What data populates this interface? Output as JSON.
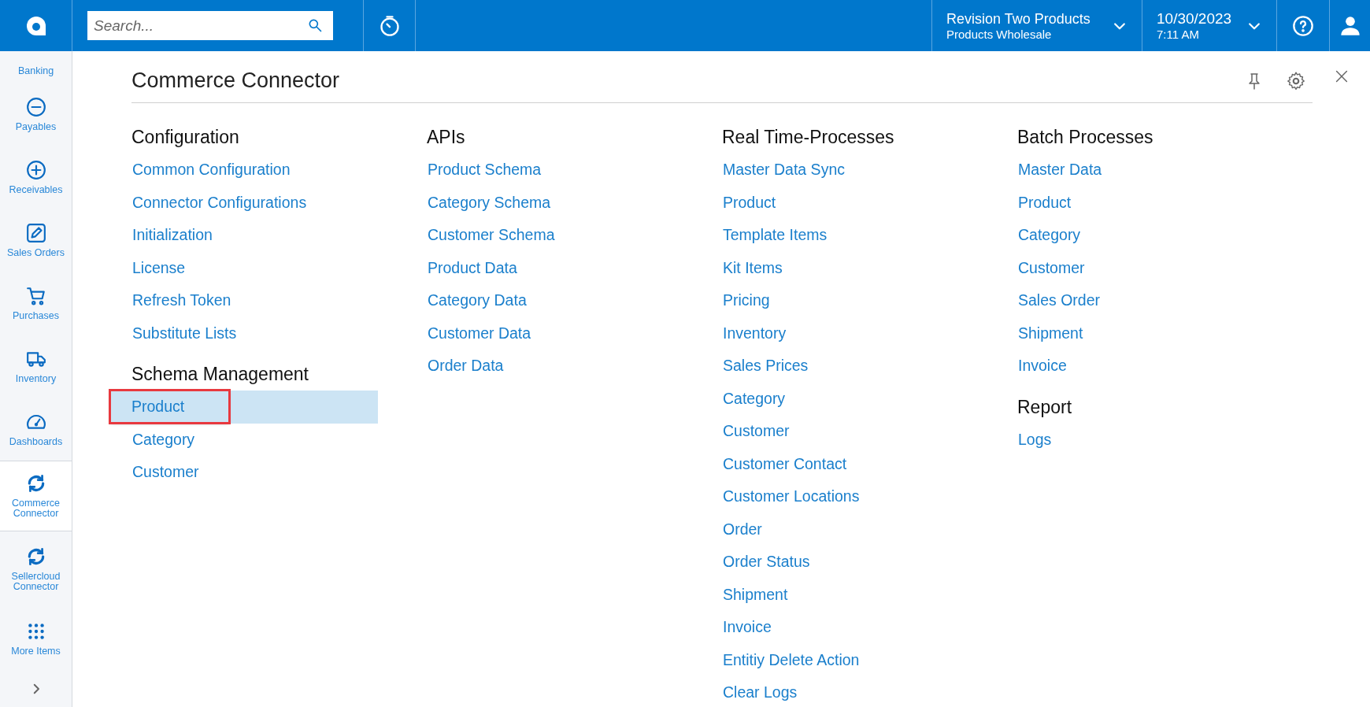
{
  "top_bar": {
    "search": {
      "placeholder": "Search..."
    },
    "company": {
      "name": "Revision Two Products",
      "branch": "Products Wholesale"
    },
    "date": {
      "date": "10/30/2023",
      "time": "7:11 AM"
    }
  },
  "sidebar": {
    "items": [
      {
        "label": "Banking",
        "selected": false
      },
      {
        "label": "Payables",
        "selected": false
      },
      {
        "label": "Receivables",
        "selected": false
      },
      {
        "label": "Sales Orders",
        "selected": false
      },
      {
        "label": "Purchases",
        "selected": false
      },
      {
        "label": "Inventory",
        "selected": false
      },
      {
        "label": "Dashboards",
        "selected": false
      },
      {
        "label": "Commerce Connector",
        "selected": true
      },
      {
        "label": "Sellercloud Connector",
        "selected": false
      },
      {
        "label": "More Items",
        "selected": false
      }
    ]
  },
  "workspace": {
    "title": "Commerce Connector",
    "columns": [
      {
        "groups": [
          {
            "heading": "Configuration",
            "links": [
              {
                "label": "Common Configuration",
                "selected": false,
                "outlined": false
              },
              {
                "label": "Connector Configurations",
                "selected": false,
                "outlined": false
              },
              {
                "label": "Initialization",
                "selected": false,
                "outlined": false
              },
              {
                "label": "License",
                "selected": false,
                "outlined": false
              },
              {
                "label": "Refresh Token",
                "selected": false,
                "outlined": false
              },
              {
                "label": "Substitute Lists",
                "selected": false,
                "outlined": false
              }
            ]
          },
          {
            "heading": "Schema Management",
            "links": [
              {
                "label": "Product",
                "selected": true,
                "outlined": true
              },
              {
                "label": "Category",
                "selected": false,
                "outlined": false
              },
              {
                "label": "Customer",
                "selected": false,
                "outlined": false
              }
            ]
          }
        ]
      },
      {
        "groups": [
          {
            "heading": "APIs",
            "links": [
              {
                "label": "Product Schema",
                "selected": false,
                "outlined": false
              },
              {
                "label": "Category Schema",
                "selected": false,
                "outlined": false
              },
              {
                "label": "Customer Schema",
                "selected": false,
                "outlined": false
              },
              {
                "label": "Product Data",
                "selected": false,
                "outlined": false
              },
              {
                "label": "Category Data",
                "selected": false,
                "outlined": false
              },
              {
                "label": "Customer Data",
                "selected": false,
                "outlined": false
              },
              {
                "label": "Order Data",
                "selected": false,
                "outlined": false
              }
            ]
          }
        ]
      },
      {
        "groups": [
          {
            "heading": "Real Time-Processes",
            "links": [
              {
                "label": "Master Data Sync",
                "selected": false,
                "outlined": false
              },
              {
                "label": "Product",
                "selected": false,
                "outlined": false
              },
              {
                "label": "Template Items",
                "selected": false,
                "outlined": false
              },
              {
                "label": "Kit Items",
                "selected": false,
                "outlined": false
              },
              {
                "label": "Pricing",
                "selected": false,
                "outlined": false
              },
              {
                "label": "Inventory",
                "selected": false,
                "outlined": false
              },
              {
                "label": "Sales Prices",
                "selected": false,
                "outlined": false
              },
              {
                "label": "Category",
                "selected": false,
                "outlined": false
              },
              {
                "label": "Customer",
                "selected": false,
                "outlined": false
              },
              {
                "label": "Customer Contact",
                "selected": false,
                "outlined": false
              },
              {
                "label": "Customer Locations",
                "selected": false,
                "outlined": false
              },
              {
                "label": "Order",
                "selected": false,
                "outlined": false
              },
              {
                "label": "Order Status",
                "selected": false,
                "outlined": false
              },
              {
                "label": "Shipment",
                "selected": false,
                "outlined": false
              },
              {
                "label": "Invoice",
                "selected": false,
                "outlined": false
              },
              {
                "label": "Entitiy Delete Action",
                "selected": false,
                "outlined": false
              },
              {
                "label": "Clear Logs",
                "selected": false,
                "outlined": false
              }
            ]
          }
        ]
      },
      {
        "groups": [
          {
            "heading": "Batch Processes",
            "links": [
              {
                "label": "Master Data",
                "selected": false,
                "outlined": false
              },
              {
                "label": "Product",
                "selected": false,
                "outlined": false
              },
              {
                "label": "Category",
                "selected": false,
                "outlined": false
              },
              {
                "label": "Customer",
                "selected": false,
                "outlined": false
              },
              {
                "label": "Sales Order",
                "selected": false,
                "outlined": false
              },
              {
                "label": "Shipment",
                "selected": false,
                "outlined": false
              },
              {
                "label": "Invoice",
                "selected": false,
                "outlined": false
              }
            ]
          },
          {
            "heading": "Report",
            "links": [
              {
                "label": "Logs",
                "selected": false,
                "outlined": false
              }
            ]
          }
        ]
      }
    ]
  }
}
